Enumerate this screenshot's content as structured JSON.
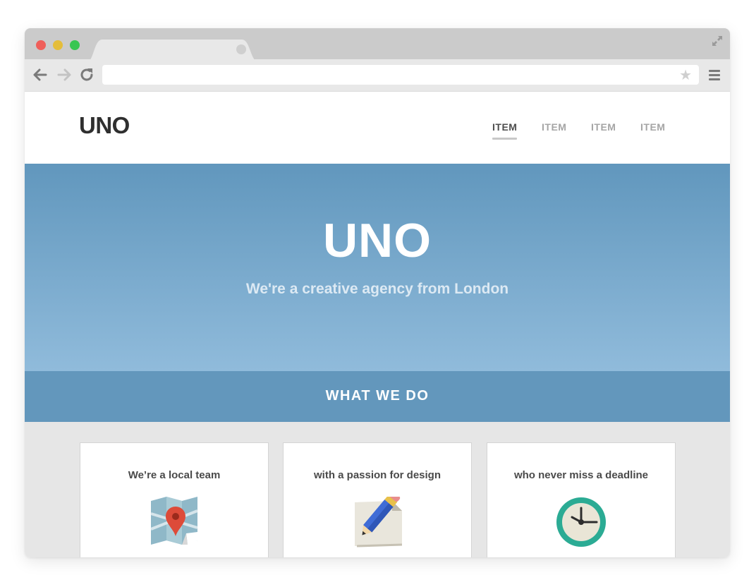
{
  "browser": {
    "icons": {
      "back": "arrow-left-icon",
      "forward": "arrow-right-icon",
      "reload": "reload-icon",
      "bookmark": "star-icon",
      "menu": "hamburger-menu-icon",
      "fullscreen": "expand-icon"
    },
    "url": "",
    "window_controls": {
      "close": "#ef5f5a",
      "minimize": "#e4bd3a",
      "maximize": "#38c652"
    }
  },
  "site": {
    "logo": "UNO",
    "nav": [
      {
        "label": "ITEM",
        "active": true
      },
      {
        "label": "ITEM",
        "active": false
      },
      {
        "label": "ITEM",
        "active": false
      },
      {
        "label": "ITEM",
        "active": false
      }
    ],
    "hero": {
      "title": "UNO",
      "subtitle": "We're a creative agency from London"
    },
    "section_title": "WHAT WE DO",
    "features": [
      {
        "title": "We’re a local team",
        "icon": "map-pin-icon"
      },
      {
        "title": "with a passion for design",
        "icon": "pencil-icon"
      },
      {
        "title": "who never miss a deadline",
        "icon": "clock-icon"
      }
    ],
    "colors": {
      "hero_top": "#6197bd",
      "hero_bottom": "#90bbdb",
      "section_band": "#6397bc",
      "features_bg": "#e6e6e6"
    }
  }
}
